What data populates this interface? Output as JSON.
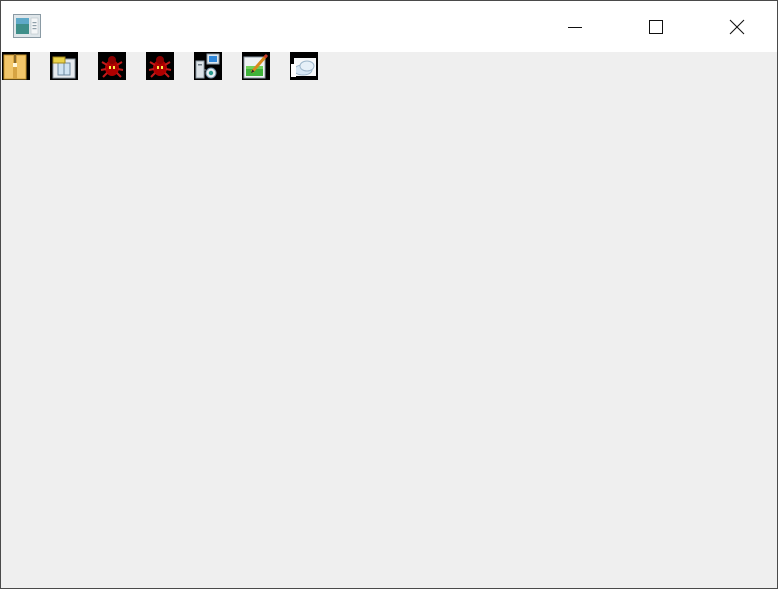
{
  "window": {
    "title": "",
    "app_icon": "application-window-icon",
    "controls": [
      {
        "name": "minimize-button",
        "icon": "minimize-icon"
      },
      {
        "name": "maximize-button",
        "icon": "maximize-icon"
      },
      {
        "name": "close-button",
        "icon": "close-icon"
      }
    ]
  },
  "toolbar": {
    "buttons": [
      {
        "name": "toolbar-button-open",
        "icon": "zip-folder-icon"
      },
      {
        "name": "toolbar-button-package",
        "icon": "package-box-icon"
      },
      {
        "name": "toolbar-button-bug-1",
        "icon": "red-bug-icon"
      },
      {
        "name": "toolbar-button-bug-2",
        "icon": "red-bug-icon"
      },
      {
        "name": "toolbar-button-network",
        "icon": "network-computer-icon"
      },
      {
        "name": "toolbar-button-edit",
        "icon": "edit-document-icon"
      },
      {
        "name": "toolbar-button-cloud",
        "icon": "cloud-icon"
      }
    ]
  },
  "colors": {
    "titlebar_bg": "#ffffff",
    "client_bg": "#efefef",
    "border": "#4a4a4a",
    "bug_red": "#b00000"
  }
}
